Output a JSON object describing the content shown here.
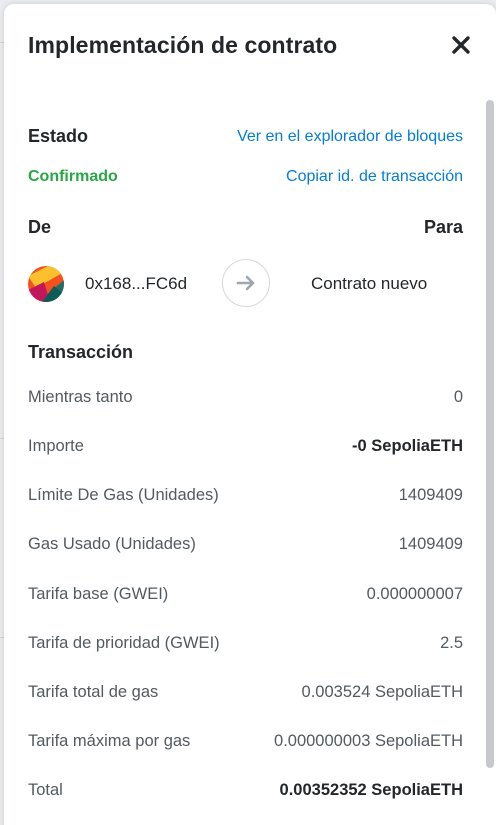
{
  "modal": {
    "title": "Implementación de contrato"
  },
  "status": {
    "label": "Estado",
    "value": "Confirmado",
    "explorer_link": "Ver en el explorador de bloques",
    "copy_link": "Copiar id. de transacción",
    "ok_color": "#28a745",
    "link_color": "#037dd6"
  },
  "parties": {
    "from_label": "De",
    "to_label": "Para",
    "from_address": "0x168...FC6d",
    "to_address": "Contrato nuevo"
  },
  "transaction": {
    "heading": "Transacción",
    "rows": [
      {
        "label": "Mientras tanto",
        "value": "0"
      },
      {
        "label": "Importe",
        "value": "-0 SepoliaETH"
      },
      {
        "label": "Límite De Gas (Unidades)",
        "value": "1409409"
      },
      {
        "label": "Gas Usado (Unidades)",
        "value": "1409409"
      },
      {
        "label": "Tarifa base (GWEI)",
        "value": "0.000000007"
      },
      {
        "label": "Tarifa de prioridad (GWEI)",
        "value": "2.5"
      },
      {
        "label": "Tarifa total de gas",
        "value": "0.003524 SepoliaETH"
      },
      {
        "label": "Tarifa máxima por gas",
        "value": "0.000000003 SepoliaETH"
      },
      {
        "label": "Total",
        "value": "0.00352352 SepoliaETH"
      }
    ]
  },
  "icons": {
    "close": "close-icon",
    "arrow": "arrow-right-icon",
    "avatar": "account-avatar-icon"
  }
}
